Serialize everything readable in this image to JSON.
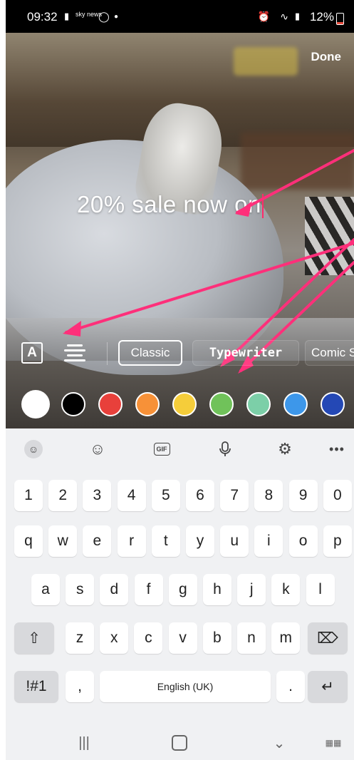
{
  "status_bar": {
    "time": "09:32",
    "news_label": "sky news",
    "battery_percent": "12%",
    "battery_level": 0.12
  },
  "editor": {
    "done_label": "Done",
    "caption_text": "20% sale now on",
    "text_tools": {
      "fonts": [
        "Classic",
        "Typewriter",
        "Comic S"
      ],
      "selected_font": "Classic"
    },
    "colors": [
      "#ffffff",
      "#000000",
      "#e8403b",
      "#f79138",
      "#f5cd3a",
      "#70c25a",
      "#7ccfa8",
      "#3d97ea",
      "#2448b5"
    ],
    "annotation_color": "#ff2f7a"
  },
  "keyboard": {
    "toolbar": [
      "sticker-icon",
      "emoji-icon",
      "gif-icon",
      "mic-icon",
      "settings-icon",
      "more-icon"
    ],
    "gif_label": "GIF",
    "more_label": "•••",
    "row_numbers": [
      "1",
      "2",
      "3",
      "4",
      "5",
      "6",
      "7",
      "8",
      "9",
      "0"
    ],
    "row_1": [
      "q",
      "w",
      "e",
      "r",
      "t",
      "y",
      "u",
      "i",
      "o",
      "p"
    ],
    "row_2": [
      "a",
      "s",
      "d",
      "f",
      "g",
      "h",
      "j",
      "k",
      "l"
    ],
    "row_3": [
      "z",
      "x",
      "c",
      "v",
      "b",
      "n",
      "m"
    ],
    "symbols_label": "!#1",
    "comma_label": ",",
    "space_label": "English (UK)",
    "period_label": ".",
    "shift_icon": "shift-icon",
    "backspace_icon": "backspace-icon",
    "enter_icon": "enter-icon"
  },
  "nav_bar": {
    "items": [
      "recents-icon",
      "home-icon",
      "back-icon",
      "keyboard-switch-icon"
    ]
  }
}
